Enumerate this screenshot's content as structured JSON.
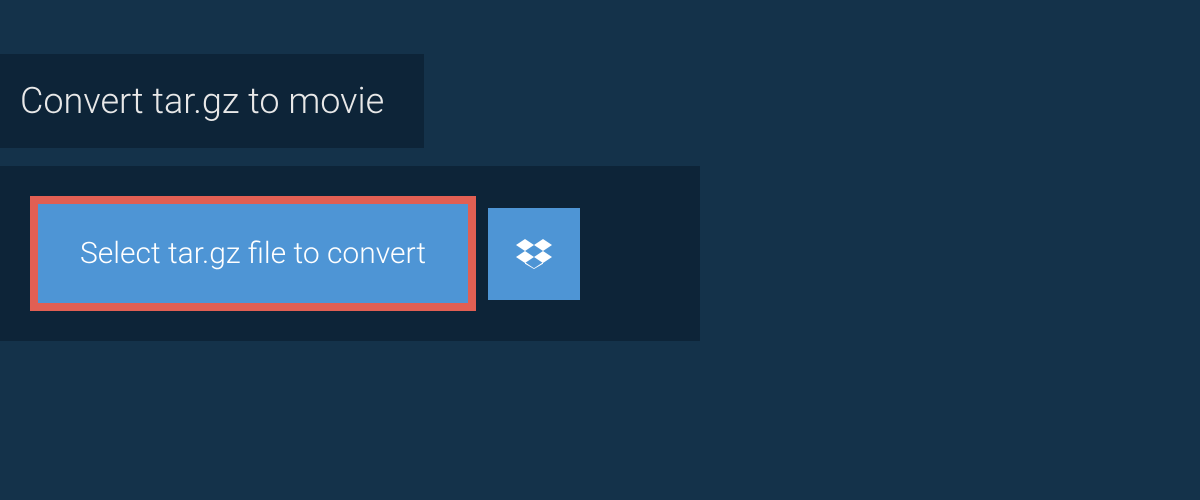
{
  "header": {
    "title": "Convert tar.gz to movie"
  },
  "actions": {
    "select_file_label": "Select tar.gz file to convert"
  },
  "colors": {
    "background": "#14324a",
    "panel": "#0d2438",
    "button": "#4e95d5",
    "highlight_border": "#e15f53"
  }
}
